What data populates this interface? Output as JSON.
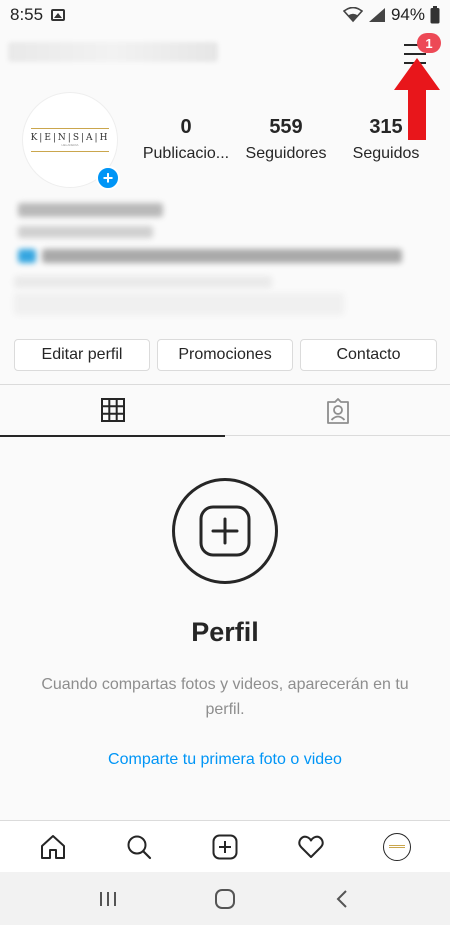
{
  "status_bar": {
    "time": "8:55",
    "battery": "94%"
  },
  "header": {
    "notification_count": "1"
  },
  "profile": {
    "logo_text": "K|E|N|S|A|H",
    "logo_subtext": "HELADERIA",
    "stats": [
      {
        "value": "0",
        "label": "Publicacio..."
      },
      {
        "value": "559",
        "label": "Seguidores"
      },
      {
        "value": "315",
        "label": "Seguidos"
      }
    ]
  },
  "actions": {
    "edit_profile": "Editar perfil",
    "promotions": "Promociones",
    "contact": "Contacto"
  },
  "empty_state": {
    "title": "Perfil",
    "description": "Cuando compartas fotos y videos, aparecerán en tu perfil.",
    "link": "Comparte tu primera foto o video"
  },
  "colors": {
    "accent_blue": "#0095f6",
    "badge_red": "#ed4956",
    "arrow_red": "#e8161b"
  },
  "icons": {
    "tabs": [
      "grid-icon",
      "tagged-icon"
    ],
    "nav": [
      "home-icon",
      "search-icon",
      "new-post-icon",
      "heart-icon",
      "profile-avatar"
    ],
    "system": [
      "recent-apps-icon",
      "home-button-icon",
      "back-icon"
    ]
  }
}
